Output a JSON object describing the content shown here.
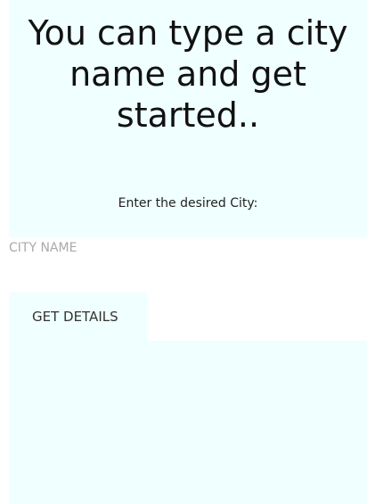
{
  "header": {
    "headline": "You can type a city name and get started.."
  },
  "form": {
    "prompt_label": "Enter the desired City:",
    "city_input": {
      "value": "",
      "placeholder": "CITY NAME"
    },
    "submit_label": "GET DETAILS"
  },
  "colors": {
    "screen_background": "#f0ffff",
    "input_background": "#ffffff"
  }
}
